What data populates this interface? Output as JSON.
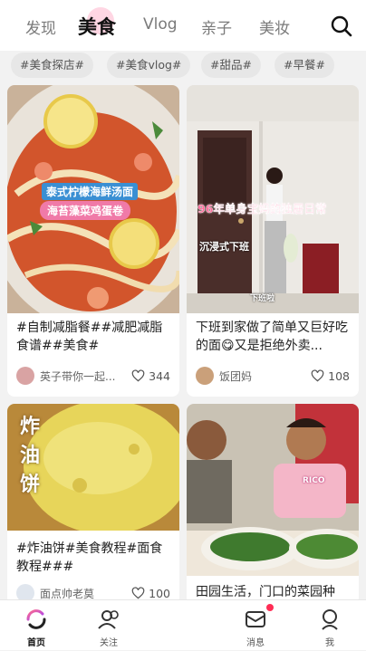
{
  "tabs": [
    {
      "label": "发现",
      "active": false
    },
    {
      "label": "美食",
      "active": true
    },
    {
      "label": "Vlog",
      "active": false
    },
    {
      "label": "亲子",
      "active": false
    },
    {
      "label": "美妆",
      "active": false
    }
  ],
  "chips": [
    "#美食探店#",
    "#美食vlog#",
    "#甜品#",
    "#早餐#"
  ],
  "cards": [
    {
      "caption": "#自制减脂餐##减肥减脂食谱##美食#",
      "author": "英子带你一起...",
      "likes": "344",
      "overlay_line1": "泰式柠檬海鲜汤面",
      "overlay_line2": "海苔藻菜鸡蛋卷"
    },
    {
      "caption": "下班到家做了简单又巨好吃的面😋又是拒绝外卖...",
      "author": "饭团妈",
      "likes": "108",
      "overlay_title": "96年单身宝妈的独居日常",
      "overlay_sub": "沉浸式下班",
      "overlay_small": "下班啦"
    },
    {
      "caption": "#炸油饼#美食教程#面食教程###",
      "author": "面点帅老莫",
      "likes": "100",
      "overlay_text": "炸\n油\n饼"
    },
    {
      "caption": "田园生活，门口的菜园种",
      "author": "",
      "likes": "",
      "overlay_shirt": "RICO"
    }
  ],
  "bottom_nav": [
    {
      "label": "首页",
      "active": true,
      "icon": "home-icon"
    },
    {
      "label": "关注",
      "active": false,
      "icon": "follow-icon"
    },
    {
      "label": "消息",
      "active": false,
      "icon": "message-icon",
      "badge": true
    },
    {
      "label": "我",
      "active": false,
      "icon": "profile-icon"
    }
  ],
  "colors": {
    "accent": "#ff2d55",
    "tab_highlight": "#ffd6e3",
    "plus_gradient_start": "#ff9a9e",
    "plus_gradient_end": "#f8bbd0"
  }
}
